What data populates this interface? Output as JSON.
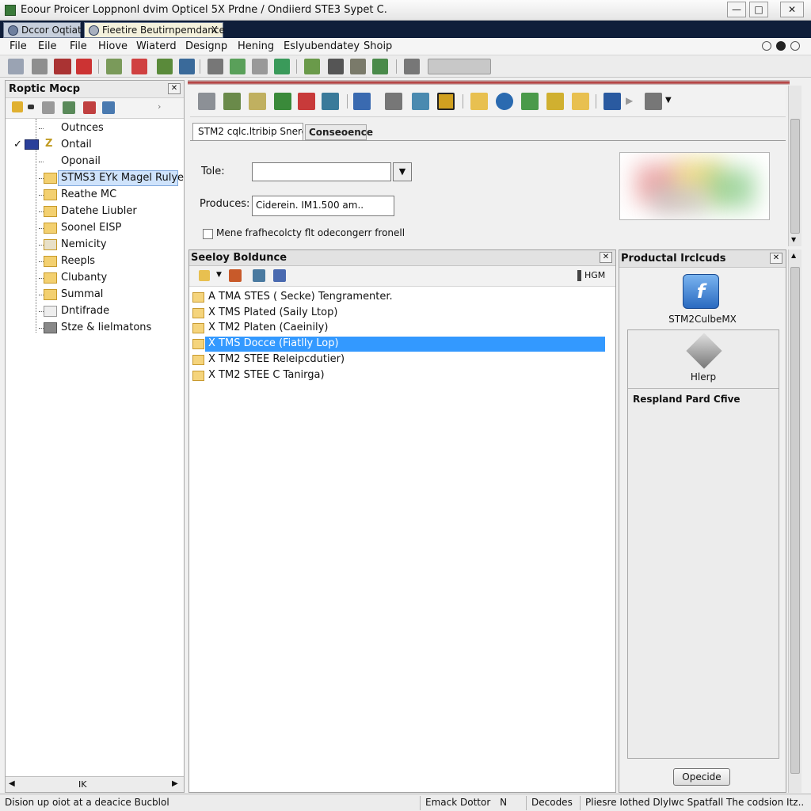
{
  "window": {
    "title": "Eoour Proicer Loppnonl dvim Opticel 5X Prdne / Ondiierd STE3 Sypet C.",
    "btn_min": "—",
    "btn_max": "□",
    "btn_close": "✕"
  },
  "doc_tabs": [
    {
      "label": "Dccor Oqtiat"
    },
    {
      "label": "Fieetire Beutirnpemdance",
      "close": "X"
    }
  ],
  "menu": [
    "File",
    "Eile",
    "File",
    "Hiove",
    "Wiaterd",
    "Designp",
    "Hening",
    "Eslyubendatey",
    "Shoip"
  ],
  "left_panel": {
    "title": "Roptic Mocp",
    "close": "✕",
    "items": [
      {
        "label": "Outnces"
      },
      {
        "label": "Ontail",
        "check": "✓"
      },
      {
        "label": "Oponail"
      },
      {
        "label": "STMS3 EYk Magel Rulye"
      },
      {
        "label": "Reathe MC"
      },
      {
        "label": "Datehe Liubler"
      },
      {
        "label": "Soonel EISP"
      },
      {
        "label": "Nemicity"
      },
      {
        "label": "Reepls"
      },
      {
        "label": "Clubanty"
      },
      {
        "label": "Summal"
      },
      {
        "label": "Dntifrade"
      },
      {
        "label": "Stze & Iielmatons"
      }
    ],
    "hscroll_label": "IK"
  },
  "config": {
    "tab_active": "STM2 cqlc.ltribip Snere",
    "tab_inactive": "Conseoence",
    "tole_label": "Tole:",
    "tole_value": "",
    "produces_label": "Produces:",
    "produces_value": "Ciderein. IM1.500 am..",
    "checkbox_label": "Mene frafhecolcty flt odecongerr fronell"
  },
  "selection": {
    "title": "Seeloy Boldunce",
    "close": "✕",
    "count": "HGM",
    "items": [
      {
        "label": "A TMA STES  ( Secke) Tengramenter."
      },
      {
        "label": "X TMS Plated (Saily Ltop)"
      },
      {
        "label": "X TM2 Platen (Caeinily)"
      },
      {
        "label": "X TMS Docce (Fiatlly Lop)"
      },
      {
        "label": "X TM2 STEE Releipcdutier)"
      },
      {
        "label": "X TM2 STEE C Tanirga)"
      }
    ]
  },
  "products": {
    "title": "Productal Irclcuds",
    "close": "✕",
    "item1": "STM2CulbeMX",
    "item2": "Hlerp",
    "section": "Respland Pard Cfive",
    "button": "Opecide"
  },
  "status": {
    "left": "Dision up oiot at a deacice Bucblol",
    "mid": "Emack Dottor",
    "mid_flag": "N",
    "decoder": "Decodes",
    "right": "Pliesre Iothed Dlylwc Spatfall The codsion Itz.."
  },
  "colors": {
    "selection": "#3399ff",
    "title_dark": "#0f1e3a",
    "accent_red": "#b23030",
    "product_icon": "#3a7fd0"
  },
  "icons": {
    "cube_icon": "blue rounded square with italic f",
    "help_icon": "grey diamond"
  }
}
